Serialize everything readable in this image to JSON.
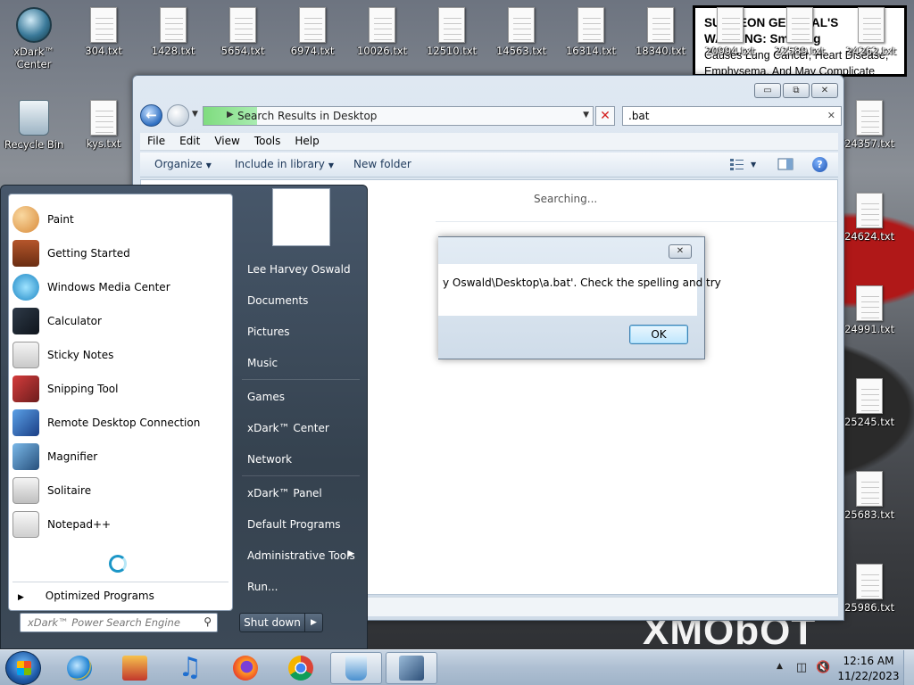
{
  "desktop": {
    "top_icons": [
      "xDark™ Center",
      "304.txt",
      "1428.txt",
      "5654.txt",
      "6974.txt",
      "10026.txt",
      "12510.txt",
      "14563.txt",
      "16314.txt",
      "18340.txt",
      "20994.txt",
      "22589.txt",
      "24262.txt"
    ],
    "left_icons": [
      "Recycle Bin",
      "kys.txt"
    ],
    "right_icons": [
      "24357.txt",
      "24624.txt",
      "24991.txt",
      "25245.txt",
      "25683.txt",
      "25986.txt"
    ],
    "warning": {
      "line1": "SURGEON GENERAL'S WARNING: Smoking",
      "line2": "Causes Lung Cancer, Heart Disease,",
      "line3": "Emphysema, And May Complicate Pregnancy."
    },
    "wallpaper_text": "XMObOT"
  },
  "explorer": {
    "address": "Search Results in Desktop",
    "search_value": ".bat",
    "menu": [
      "File",
      "Edit",
      "View",
      "Tools",
      "Help"
    ],
    "commands": {
      "organize": "Organize",
      "include": "Include in library",
      "new_folder": "New folder"
    },
    "status": "Searching...",
    "controls": {
      "minimize": "▭",
      "restore": "⧉",
      "close": "✕"
    }
  },
  "dialog": {
    "message": "y Oswald\\Desktop\\a.bat'.  Check the spelling and try",
    "ok": "OK",
    "close": "✕"
  },
  "start_menu": {
    "programs": [
      "Paint",
      "Getting Started",
      "Windows Media Center",
      "Calculator",
      "Sticky Notes",
      "Snipping Tool",
      "Remote Desktop Connection",
      "Magnifier",
      "Solitaire",
      "Notepad++"
    ],
    "all_programs": "Optimized Programs",
    "search_placeholder": "xDark™ Power Search Engine",
    "right": [
      "Lee Harvey Oswald",
      "Documents",
      "Pictures",
      "Music",
      "Games",
      "xDark™ Center",
      "Network",
      "xDark™ Panel",
      "Default Programs",
      "Administrative Tools",
      "Run..."
    ],
    "shutdown": "Shut down"
  },
  "taskbar": {
    "time": "12:16 AM",
    "date": "11/22/2023",
    "apps": [
      "internet-explorer",
      "store",
      "music",
      "firefox",
      "chrome",
      "recycle",
      "network-app"
    ]
  },
  "colors": {
    "start_menu_bg": "#3c4957",
    "taskbar_bg": "#aebfd2",
    "accent_blue": "#2f6fc1"
  }
}
